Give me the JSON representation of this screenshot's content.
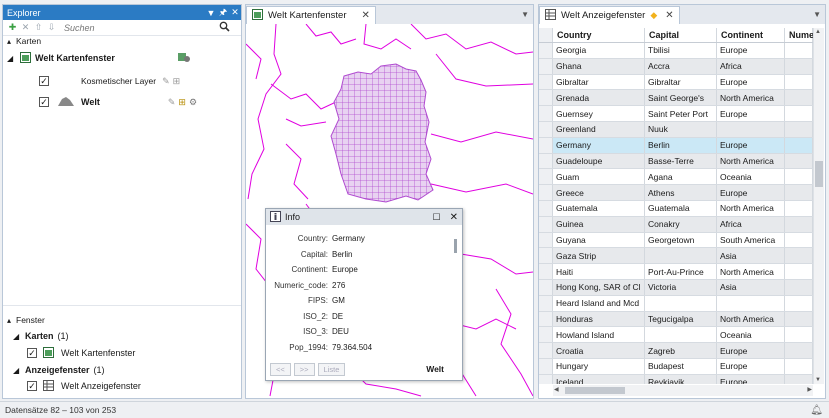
{
  "explorer": {
    "title": "Explorer",
    "search_placeholder": "Suchen",
    "karten_label": "Karten",
    "map_node": "Welt Kartenfenster",
    "layers": [
      {
        "name": "Kosmetischer Layer",
        "checked": true
      },
      {
        "name": "Welt",
        "checked": true
      }
    ],
    "fenster_label": "Fenster",
    "groups": [
      {
        "label": "Karten",
        "count": "(1)",
        "item": "Welt Kartenfenster"
      },
      {
        "label": "Anzeigefenster",
        "count": "(1)",
        "item": "Welt Anzeigefenster"
      }
    ]
  },
  "map_window": {
    "tab_label": "Welt Kartenfenster"
  },
  "info_panel": {
    "title": "Info",
    "fields": [
      {
        "key": "Country:",
        "value": "Germany"
      },
      {
        "key": "Capital:",
        "value": "Berlin"
      },
      {
        "key": "Continent:",
        "value": "Europe"
      },
      {
        "key": "Numeric_code:",
        "value": "276"
      },
      {
        "key": "FIPS:",
        "value": "GM"
      },
      {
        "key": "ISO_2:",
        "value": "DE"
      },
      {
        "key": "ISO_3:",
        "value": "DEU"
      },
      {
        "key": "Pop_1994:",
        "value": "79.364.504"
      }
    ],
    "prev_label": "<<",
    "next_label": ">>",
    "list_label": "Liste",
    "layer_name": "Welt"
  },
  "table_window": {
    "tab_label": "Welt Anzeigefenster",
    "columns": [
      "Country",
      "Capital",
      "Continent",
      "Nume"
    ],
    "rows": [
      [
        "Georgia",
        "Tbilisi",
        "Europe",
        ""
      ],
      [
        "Ghana",
        "Accra",
        "Africa",
        ""
      ],
      [
        "Gibraltar",
        "Gibraltar",
        "Europe",
        ""
      ],
      [
        "Grenada",
        "Saint George's",
        "North America",
        ""
      ],
      [
        "Guernsey",
        "Saint Peter Port",
        "Europe",
        ""
      ],
      [
        "Greenland",
        "Nuuk",
        "",
        ""
      ],
      [
        "Germany",
        "Berlin",
        "Europe",
        ""
      ],
      [
        "Guadeloupe",
        "Basse-Terre",
        "North America",
        ""
      ],
      [
        "Guam",
        "Agana",
        "Oceania",
        ""
      ],
      [
        "Greece",
        "Athens",
        "Europe",
        ""
      ],
      [
        "Guatemala",
        "Guatemala",
        "North America",
        ""
      ],
      [
        "Guinea",
        "Conakry",
        "Africa",
        ""
      ],
      [
        "Guyana",
        "Georgetown",
        "South America",
        ""
      ],
      [
        "Gaza Strip",
        "",
        "Asia",
        ""
      ],
      [
        "Haiti",
        "Port-Au-Prince",
        "North America",
        ""
      ],
      [
        "Hong Kong, SAR of Cl",
        "Victoria",
        "Asia",
        ""
      ],
      [
        "Heard Island and Mcd",
        "",
        "",
        ""
      ],
      [
        "Honduras",
        "Tegucigalpa",
        "North America",
        ""
      ],
      [
        "Howland Island",
        "",
        "Oceania",
        ""
      ],
      [
        "Croatia",
        "Zagreb",
        "Europe",
        ""
      ],
      [
        "Hungary",
        "Budapest",
        "Europe",
        ""
      ],
      [
        "Iceland",
        "Reykjavik",
        "Europe",
        ""
      ]
    ],
    "selected_row": 6
  },
  "status_bar": {
    "text": "Datensätze 82 – 103 von 253"
  },
  "colors": {
    "accent": "#2b7bc4",
    "map_lines": "#e000e0",
    "selection_fill": "#c6a4d8",
    "row_selected": "#cbe8f6",
    "row_alt": "#e7e9ec",
    "highlight_star": "#f2b21c"
  }
}
